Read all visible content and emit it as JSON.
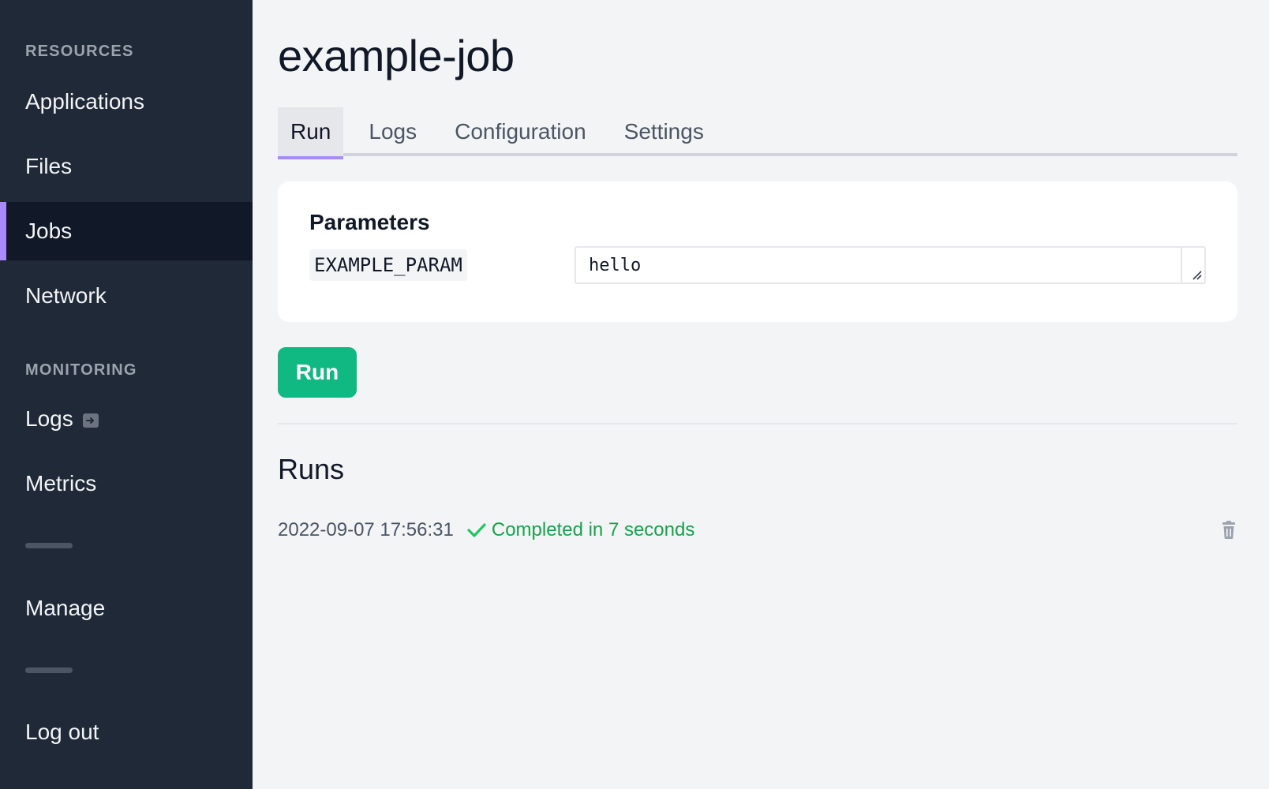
{
  "sidebar": {
    "sections": [
      {
        "header": "RESOURCES",
        "items": [
          "Applications",
          "Files",
          "Jobs",
          "Network"
        ]
      },
      {
        "header": "MONITORING",
        "items": [
          "Logs",
          "Metrics"
        ]
      }
    ],
    "resources_header": "RESOURCES",
    "monitoring_header": "MONITORING",
    "applications": "Applications",
    "files": "Files",
    "jobs": "Jobs",
    "network": "Network",
    "logs": "Logs",
    "metrics": "Metrics",
    "manage": "Manage",
    "logout": "Log out",
    "active_item": "Jobs"
  },
  "page": {
    "title": "example-job"
  },
  "tabs": {
    "run": "Run",
    "logs": "Logs",
    "configuration": "Configuration",
    "settings": "Settings",
    "active": "Run"
  },
  "parameters": {
    "title": "Parameters",
    "name": "EXAMPLE_PARAM",
    "value": "hello"
  },
  "run_button": "Run",
  "runs": {
    "title": "Runs",
    "items": [
      {
        "timestamp": "2022-09-07 17:56:31",
        "status": "Completed in 7 seconds"
      }
    ]
  },
  "colors": {
    "sidebar_bg": "#1f2937",
    "accent": "#a78bfa",
    "success": "#10b981"
  }
}
